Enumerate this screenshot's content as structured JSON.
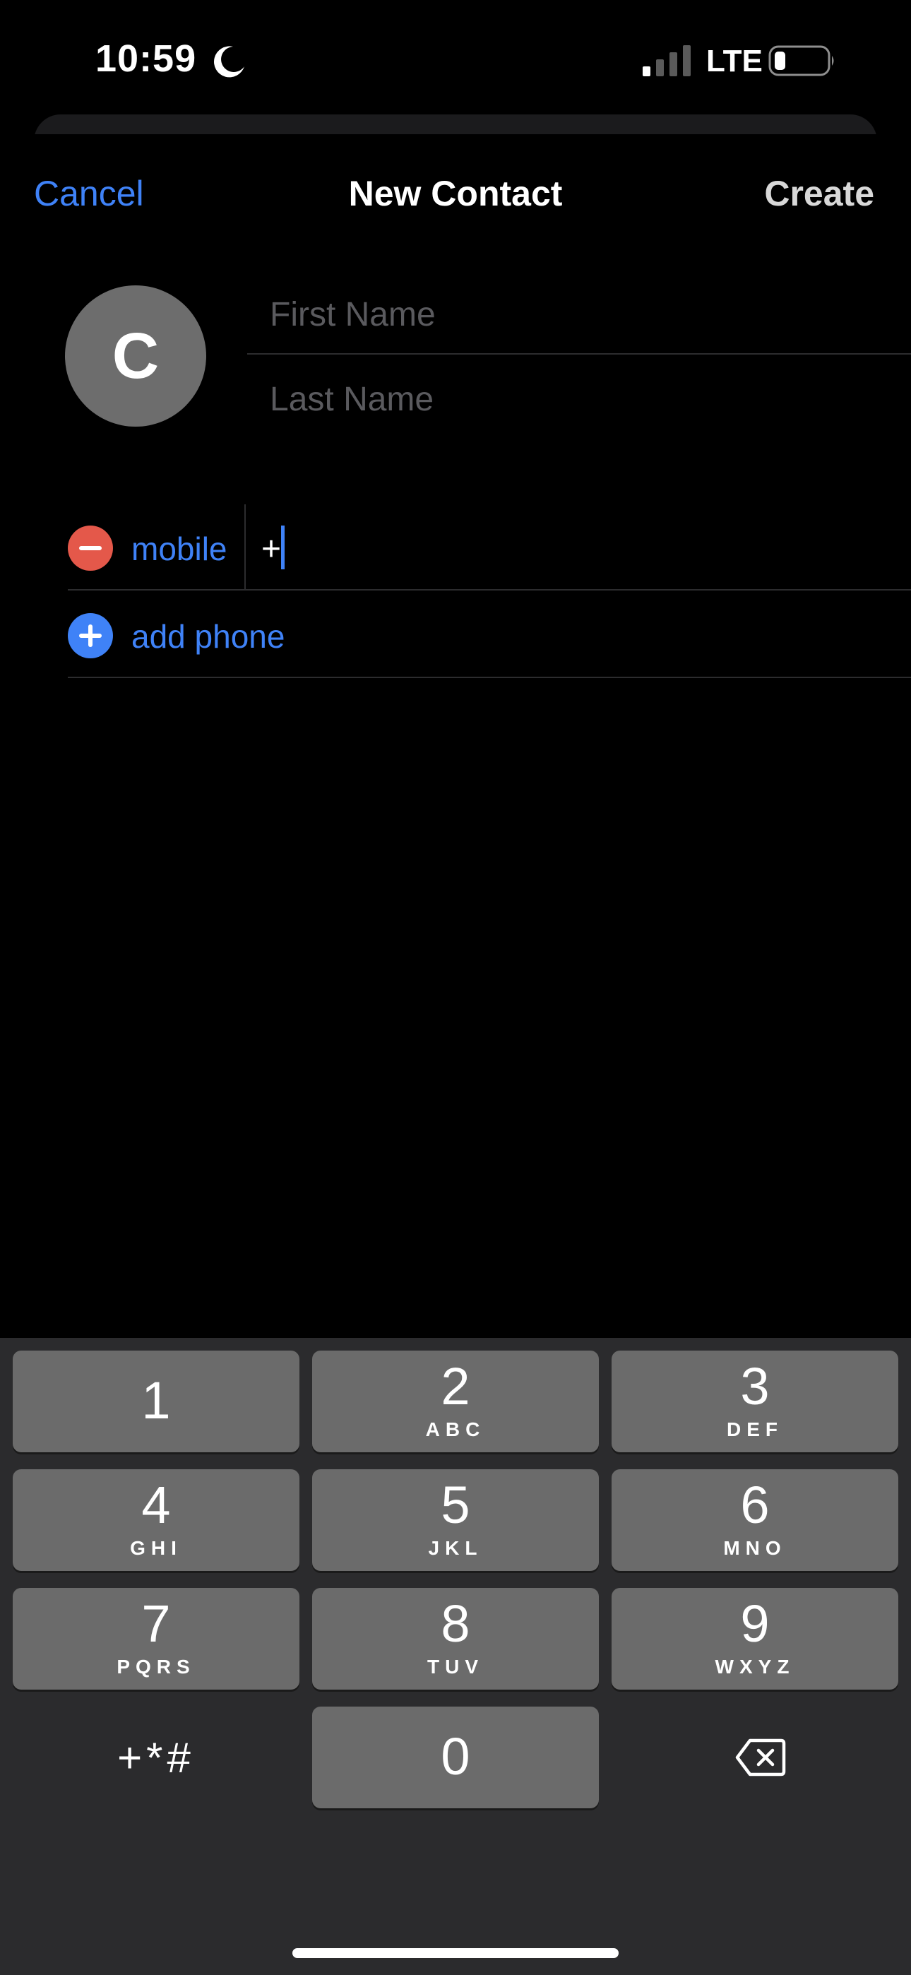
{
  "status_bar": {
    "time": "10:59",
    "focus_icon": "moon-icon",
    "signal_icon": "cellular-signal-icon",
    "network": "LTE",
    "battery_icon": "battery-icon"
  },
  "nav": {
    "cancel_label": "Cancel",
    "title": "New Contact",
    "create_label": "Create"
  },
  "avatar": {
    "initial": "C",
    "color": "#6d6d6d"
  },
  "name_fields": {
    "first_placeholder": "First Name",
    "last_placeholder": "Last Name"
  },
  "phone": {
    "label": "mobile",
    "value": "+",
    "add_label": "add phone",
    "remove_icon": "minus-circle-icon",
    "add_icon": "plus-circle-icon"
  },
  "keypad": {
    "keys": [
      {
        "digit": "1",
        "letters": ""
      },
      {
        "digit": "2",
        "letters": "ABC"
      },
      {
        "digit": "3",
        "letters": "DEF"
      },
      {
        "digit": "4",
        "letters": "GHI"
      },
      {
        "digit": "5",
        "letters": "JKL"
      },
      {
        "digit": "6",
        "letters": "MNO"
      },
      {
        "digit": "7",
        "letters": "PQRS"
      },
      {
        "digit": "8",
        "letters": "TUV"
      },
      {
        "digit": "9",
        "letters": "WXYZ"
      },
      {
        "digit": "0",
        "letters": ""
      }
    ],
    "symbols_label": "+*#",
    "delete_icon": "backspace-icon"
  },
  "colors": {
    "accent": "#3f82f7",
    "destructive": "#e4584a",
    "background": "#000000",
    "keypad_background": "#2b2b2d",
    "key_background": "#6b6b6b"
  }
}
